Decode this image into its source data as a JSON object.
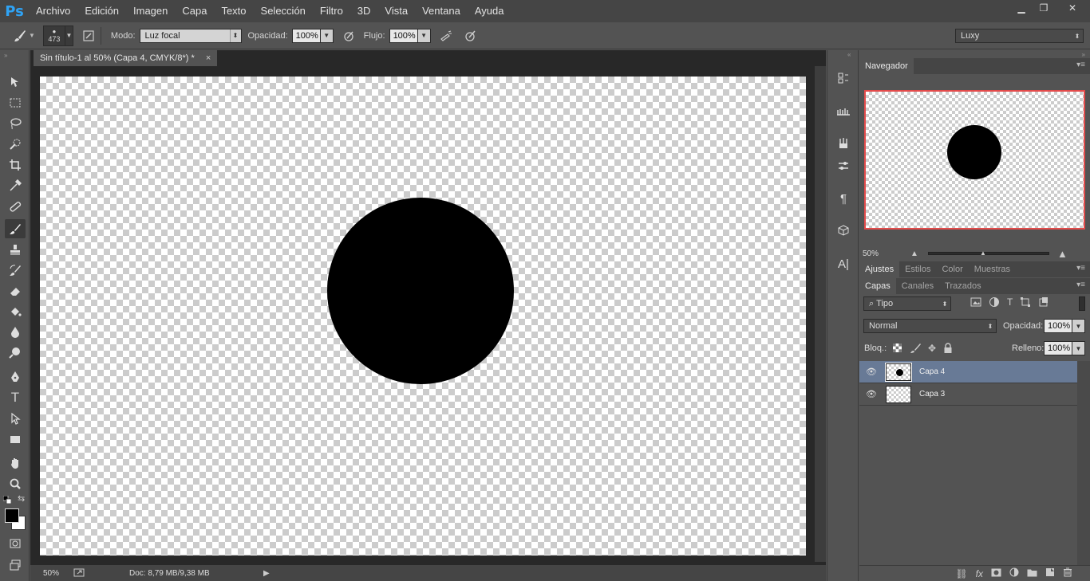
{
  "app": {
    "logo": "Ps"
  },
  "menu": [
    "Archivo",
    "Edición",
    "Imagen",
    "Capa",
    "Texto",
    "Selección",
    "Filtro",
    "3D",
    "Vista",
    "Ventana",
    "Ayuda"
  ],
  "window_controls": {
    "minimize": "▁",
    "restore": "❐",
    "close": "✕"
  },
  "options": {
    "brush_size": "473",
    "mode_label": "Modo:",
    "mode_value": "Luz focal",
    "opacity_label": "Opacidad:",
    "opacity_value": "100%",
    "flow_label": "Flujo:",
    "flow_value": "100%",
    "workspace": "Luxy"
  },
  "document": {
    "tab_title": "Sin título-1 al 50% (Capa 4, CMYK/8*) *",
    "tab_close": "×",
    "zoom": "50%",
    "doc_info": "Doc: 8,79 MB/9,38 MB"
  },
  "navigator": {
    "tab": "Navegador",
    "zoom": "50%"
  },
  "panels": {
    "adjust_tabs": [
      "Ajustes",
      "Estilos",
      "Color",
      "Muestras"
    ],
    "layer_tabs": [
      "Capas",
      "Canales",
      "Trazados"
    ],
    "filter_kind": "Tipo",
    "blend_mode": "Normal",
    "opacity_label": "Opacidad:",
    "opacity_value": "100%",
    "lock_label": "Bloq.:",
    "fill_label": "Relleno:",
    "fill_value": "100%"
  },
  "layers": [
    {
      "name": "Capa 4",
      "selected": true
    },
    {
      "name": "Capa 3",
      "selected": false
    }
  ],
  "colors": {
    "accent_selected_layer": "#687a96",
    "navigator_frame": "#e34b4b",
    "ps_logo": "#2fa3f5"
  }
}
